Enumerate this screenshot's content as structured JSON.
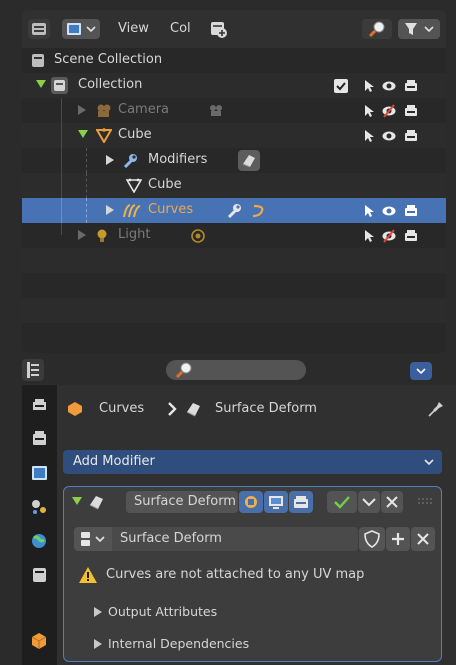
{
  "outliner": {
    "header": {
      "view_label": "View",
      "col_label": "Col"
    },
    "rows": [
      {
        "label": "Scene Collection",
        "icon": "scene-collection-icon"
      },
      {
        "label": "Collection",
        "icon": "collection-icon",
        "checked": true
      },
      {
        "label": "Camera",
        "icon": "camera-icon",
        "disabled": true
      },
      {
        "label": "Cube",
        "icon": "mesh-object-icon"
      },
      {
        "label": "Modifiers",
        "icon": "wrench-icon"
      },
      {
        "label": "Cube",
        "icon": "mesh-data-icon"
      },
      {
        "label": "Curves",
        "icon": "curves-icon",
        "selected": true
      },
      {
        "label": "Light",
        "icon": "light-icon",
        "disabled": true
      }
    ]
  },
  "properties": {
    "breadcrumb": {
      "object": "Curves",
      "separator": "›",
      "modifier": "Surface Deform"
    },
    "add_modifier_label": "Add Modifier",
    "modifier": {
      "name": "Surface Deform",
      "node_group_name": "Surface Deform",
      "warning": "Curves are not attached to any UV map",
      "sections": [
        "Output Attributes",
        "Internal Dependencies"
      ]
    }
  },
  "colors": {
    "selection": "#4772b3",
    "accent_green": "#8ad04b",
    "warning": "#f2c12e",
    "curves_orange": "#e8a33c"
  }
}
